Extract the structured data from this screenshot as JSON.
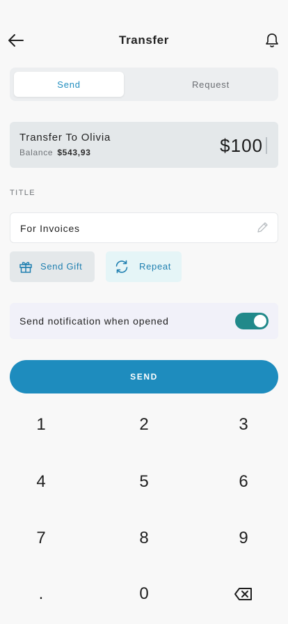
{
  "header": {
    "title": "Transfer",
    "back_icon": "arrow-left-icon",
    "notification_icon": "bell-icon"
  },
  "tabs": [
    {
      "label": "Send",
      "selected": true
    },
    {
      "label": "Request",
      "selected": false
    }
  ],
  "transfer": {
    "to_label": "Transfer To Olivia",
    "balance_label": "Balance",
    "balance_value": "$543,93",
    "amount": "$100"
  },
  "title_field": {
    "label": "TITLE",
    "value": "For Invoices",
    "edit_icon": "pencil-icon"
  },
  "options": {
    "gift": {
      "label": "Send Gift",
      "icon": "gift-icon"
    },
    "repeat": {
      "label": "Repeat",
      "icon": "repeat-icon"
    }
  },
  "notification": {
    "label": "Send notification when opened",
    "enabled": true
  },
  "send_button": {
    "label": "SEND"
  },
  "keypad": {
    "keys": [
      "1",
      "2",
      "3",
      "4",
      "5",
      "6",
      "7",
      "8",
      "9",
      ".",
      "0"
    ],
    "backspace_icon": "backspace-icon"
  },
  "colors": {
    "primary": "#1e8cbe",
    "toggle_on": "#21898a",
    "card_bg": "#e4e8ea",
    "repeat_bg": "#e5f5f7",
    "notif_bg": "#f1f1f9",
    "background": "#f8f8f8"
  }
}
